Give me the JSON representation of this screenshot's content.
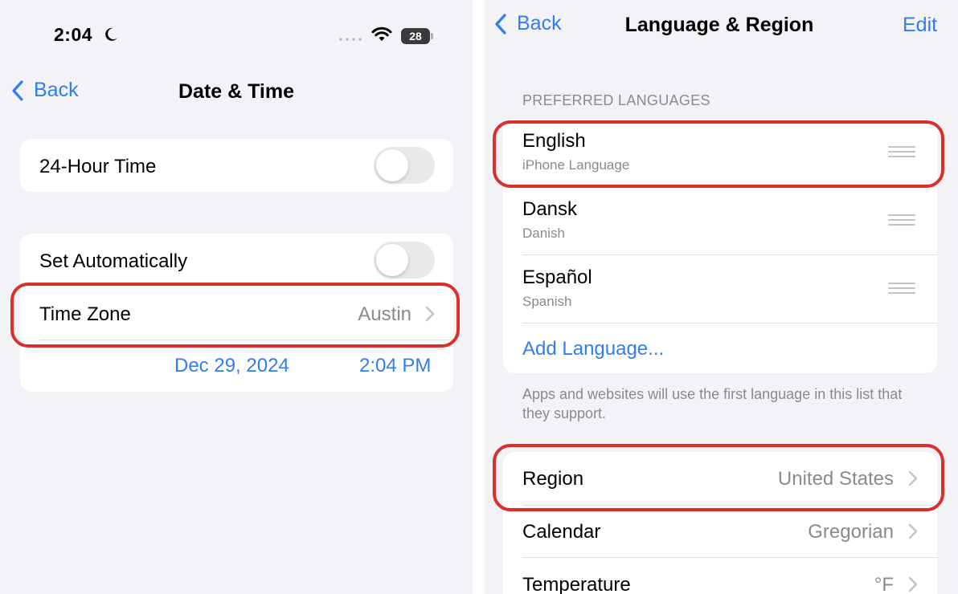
{
  "left": {
    "status_bar": {
      "time": "2:04",
      "battery_level": "28",
      "moon_icon": "moon-icon",
      "wifi_icon": "wifi-icon",
      "signal_icon": "cellular-dots-icon"
    },
    "nav": {
      "back_label": "Back",
      "title": "Date & Time"
    },
    "rows": {
      "twenty_four_hour": {
        "label": "24-Hour Time",
        "on": false
      },
      "set_automatically": {
        "label": "Set Automatically",
        "on": false
      },
      "time_zone": {
        "label": "Time Zone",
        "value": "Austin"
      },
      "date": "Dec 29, 2024",
      "time": "2:04 PM"
    }
  },
  "right": {
    "nav": {
      "back_label": "Back",
      "title": "Language & Region",
      "edit_label": "Edit"
    },
    "preferred_languages": {
      "header": "PREFERRED LANGUAGES",
      "items": [
        {
          "name": "English",
          "sub": "iPhone Language"
        },
        {
          "name": "Dansk",
          "sub": "Danish"
        },
        {
          "name": "Español",
          "sub": "Spanish"
        }
      ],
      "add_label": "Add Language...",
      "footer": "Apps and websites will use the first language in this list that they support."
    },
    "settings": [
      {
        "label": "Region",
        "value": "United States"
      },
      {
        "label": "Calendar",
        "value": "Gregorian"
      },
      {
        "label": "Temperature",
        "value": "°F"
      }
    ]
  },
  "colors": {
    "accent": "#2f7ef0",
    "highlight": "#d9302c",
    "background": "#f2f2f7"
  }
}
